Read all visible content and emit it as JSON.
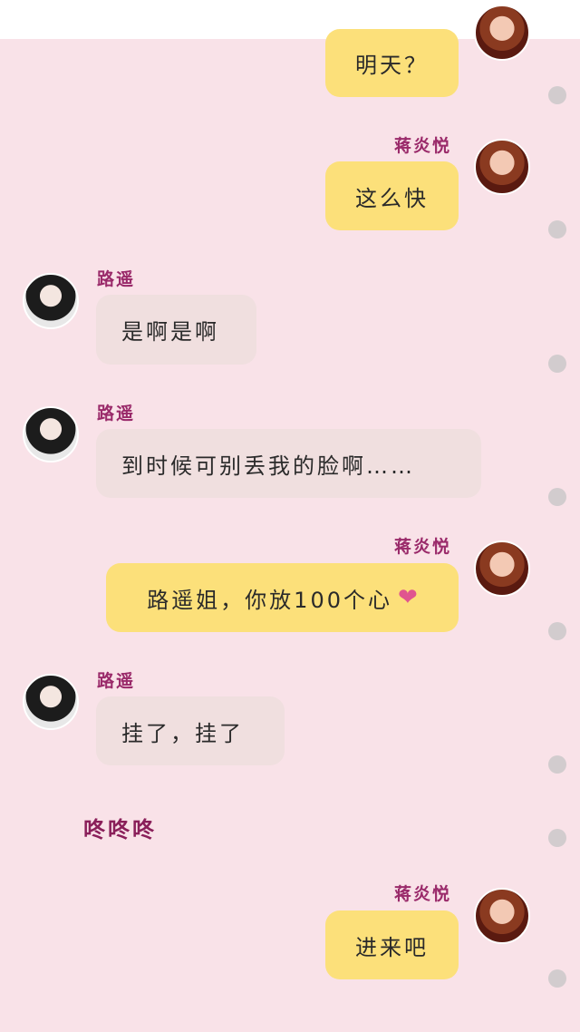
{
  "messages": [
    {
      "side": "right",
      "text": "明天？"
    },
    {
      "side": "right",
      "name": "蒋炎悦",
      "text": "这么快"
    },
    {
      "side": "left",
      "name": "路遥",
      "text": "是啊是啊"
    },
    {
      "side": "left",
      "name": "路遥",
      "text": "到时候可别丢我的脸啊……"
    },
    {
      "side": "right",
      "name": "蒋炎悦",
      "text": "路遥姐，你放100个心",
      "emoji": "❤"
    },
    {
      "side": "left",
      "name": "路遥",
      "text": "挂了，挂了"
    },
    {
      "side": "right",
      "name": "蒋炎悦",
      "text": "进来吧"
    }
  ],
  "narration": "咚咚咚",
  "colors": {
    "background": "#f9e2e8",
    "right_bubble": "#fce07a",
    "left_bubble": "#f0dfdf",
    "name_text": "#9a2a6a",
    "heart": "#e0558f"
  },
  "icons": {
    "avatar_right": "avatar-jiang-yanyue",
    "avatar_left": "avatar-lu-yao",
    "reaction_dot": "circle-dot-icon"
  }
}
